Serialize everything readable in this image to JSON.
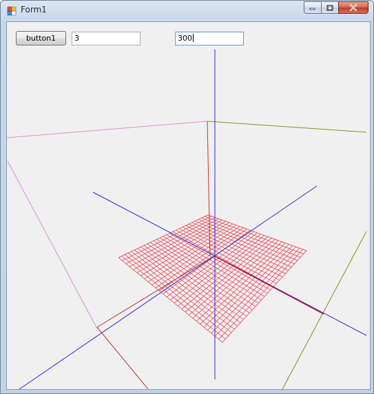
{
  "window": {
    "title": "Form1"
  },
  "controls": {
    "button1_label": "button1",
    "textbox1_value": "3",
    "textbox2_value": "300"
  },
  "colors": {
    "axis_blue": "#2a2ad6",
    "axis_red": "#d01c1c",
    "box_pink": "#e08ee0",
    "box_olive": "#8a8a1a",
    "mesh_red": "#e63040",
    "client_bg": "#f0f0f0"
  },
  "icons": [
    "app-icon",
    "minimize-icon",
    "maximize-icon",
    "close-icon"
  ]
}
